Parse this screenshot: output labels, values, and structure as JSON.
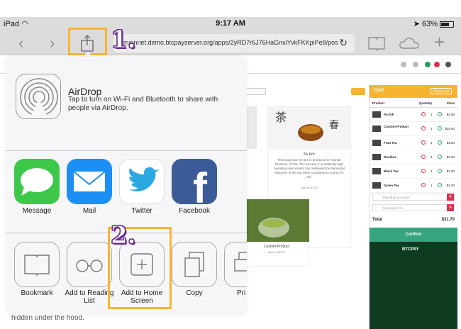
{
  "status_bar": {
    "device": "iPad",
    "time": "9:17 AM",
    "battery": "63%"
  },
  "toolbar": {
    "url": "mainnet.demo.btcpayserver.org/apps/2yRD7r6J76HaGnxiYvkFKKpiPe8/pos"
  },
  "annotations": {
    "step1": "1.",
    "step2": "2."
  },
  "share_sheet": {
    "airdrop_title": "AirDrop",
    "airdrop_desc": "Tap to turn on Wi-Fi and Bluetooth to share with people via AirDrop.",
    "apps": [
      {
        "label": "Message",
        "icon": "message-icon"
      },
      {
        "label": "Mail",
        "icon": "mail-icon"
      },
      {
        "label": "Twitter",
        "icon": "twitter-icon"
      },
      {
        "label": "Facebook",
        "icon": "facebook-icon"
      }
    ],
    "actions": [
      {
        "label": "Bookmark",
        "icon": "bookmark-icon"
      },
      {
        "label": "Add to Reading List",
        "icon": "reading-list-icon"
      },
      {
        "label": "Add to Home Screen",
        "icon": "add-home-screen-icon"
      },
      {
        "label": "Copy",
        "icon": "copy-icon"
      },
      {
        "label": "Pri",
        "icon": "print-icon"
      }
    ]
  },
  "page": {
    "products": [
      {
        "name": "Pu Erh",
        "desc": "This loose pur-erh tea is produced in Yunnan Province, China. The process in a relatively high humidity environment has mellowed the elemental character of the tea when compared to young Pu-erh.",
        "button": "Buy for $2.00"
      },
      {
        "name": "Custom Product",
        "button": "Buy for $0.00"
      }
    ],
    "hidden_text": "hidden under the hood."
  },
  "cart": {
    "title": "Cart",
    "empty_label": "Empty cart",
    "col_product": "Product",
    "col_quantity": "Quantity",
    "col_price": "Price",
    "items": [
      {
        "name": "Pu Erh",
        "qty": "1",
        "price": "$2.00"
      },
      {
        "name": "Custom Product",
        "qty": "1",
        "price": "$25.00"
      },
      {
        "name": "Fruit Tea",
        "qty": "1",
        "price": "$1.50"
      },
      {
        "name": "Rooibos",
        "qty": "1",
        "price": "$1.20"
      },
      {
        "name": "Black Tea",
        "qty": "1",
        "price": "$1.00"
      },
      {
        "name": "Green Tea",
        "qty": "1",
        "price": "$1.00"
      }
    ],
    "pay_placeholder": "Pay what you want",
    "discount_placeholder": "Discount in %",
    "total_label": "Total",
    "total_value": "$31.70",
    "confirm_label": "Confirm",
    "brand": "BTCPAY"
  },
  "colors": {
    "accent": "#f7b431",
    "annotation": "#6b2f8e",
    "confirm": "#34a57d",
    "footer": "#0f3b21"
  }
}
